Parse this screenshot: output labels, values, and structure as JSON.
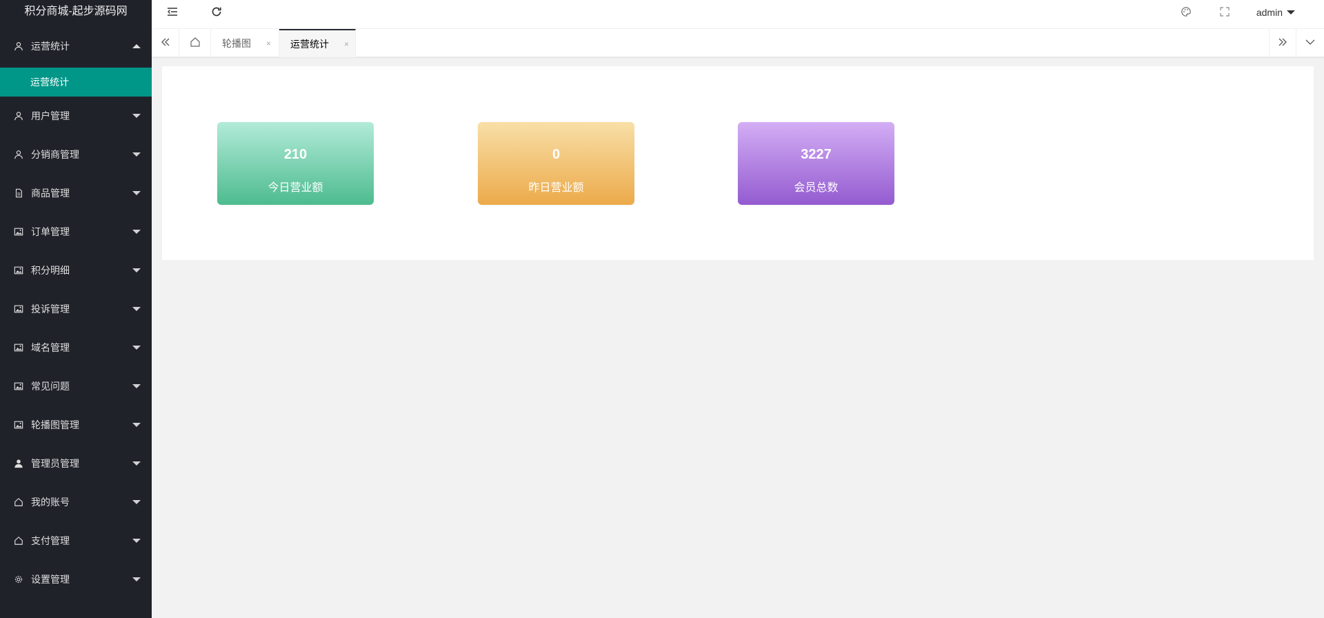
{
  "app": {
    "title": "积分商城-起步源码网"
  },
  "sidebar": {
    "items": [
      {
        "label": "运营统计",
        "icon": "user-icon",
        "expanded": true,
        "children": [
          {
            "label": "运营统计",
            "active": true
          }
        ]
      },
      {
        "label": "用户管理",
        "icon": "user-icon"
      },
      {
        "label": "分销商管理",
        "icon": "user-icon"
      },
      {
        "label": "商品管理",
        "icon": "file-icon"
      },
      {
        "label": "订单管理",
        "icon": "image-icon"
      },
      {
        "label": "积分明细",
        "icon": "image-icon"
      },
      {
        "label": "投诉管理",
        "icon": "image-icon"
      },
      {
        "label": "域名管理",
        "icon": "image-icon"
      },
      {
        "label": "常见问题",
        "icon": "image-icon"
      },
      {
        "label": "轮播图管理",
        "icon": "image-icon"
      },
      {
        "label": "管理员管理",
        "icon": "user-solid-icon"
      },
      {
        "label": "我的账号",
        "icon": "home-icon"
      },
      {
        "label": "支付管理",
        "icon": "home-icon"
      },
      {
        "label": "设置管理",
        "icon": "gear-icon"
      }
    ]
  },
  "header": {
    "user": "admin",
    "icons": [
      "menu-fold-icon",
      "refresh-icon",
      "palette-icon",
      "fullscreen-icon"
    ]
  },
  "tabs": {
    "items": [
      {
        "label": "轮播图",
        "active": false
      },
      {
        "label": "运营统计",
        "active": true
      }
    ],
    "close_glyph": "×"
  },
  "stats": [
    {
      "value": "210",
      "label": "今日营业额",
      "color": "green"
    },
    {
      "value": "0",
      "label": "昨日营业额",
      "color": "orange"
    },
    {
      "value": "3227",
      "label": "会员总数",
      "color": "purple"
    }
  ],
  "colors": {
    "sidebar_bg": "#20222a",
    "active_item": "#009688",
    "page_bg": "#f2f2f2"
  }
}
